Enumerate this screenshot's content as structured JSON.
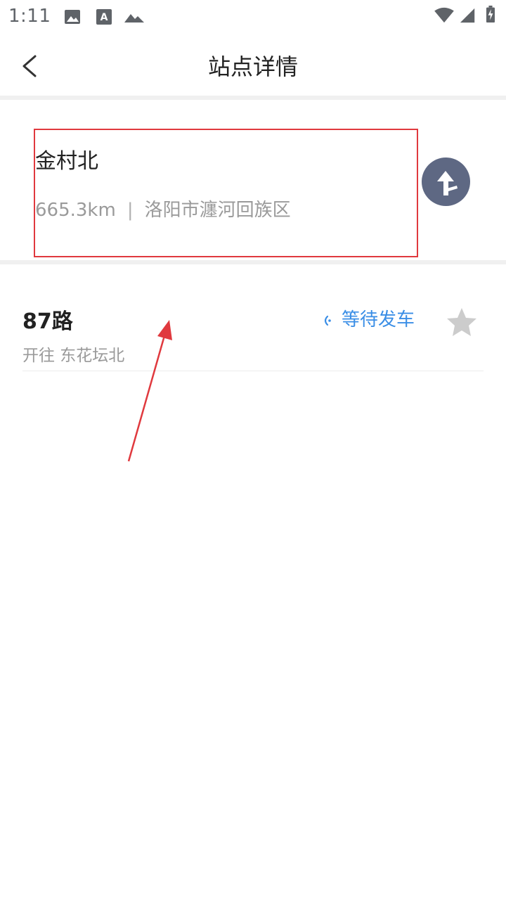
{
  "status_bar": {
    "time": "1:11",
    "icons": [
      "image-icon",
      "font-a-icon",
      "mountain-icon",
      "wifi-icon",
      "signal-icon",
      "battery-charging-icon"
    ]
  },
  "header": {
    "title": "站点详情",
    "back_icon": "chevron-left-icon"
  },
  "station": {
    "name": "金村北",
    "distance": "665.3km",
    "separator": "|",
    "district": "洛阳市瀍河回族区",
    "nav_icon": "turn-arrow-icon"
  },
  "routes": [
    {
      "name": "87路",
      "direction": "开往 东花坛北",
      "status": "等待发车",
      "status_icon": "signal-wave-icon",
      "favorite_icon": "star-icon"
    }
  ],
  "colors": {
    "accent": "#3a8ee6",
    "nav_button": "#5e6883",
    "highlight": "#e0393e",
    "star": "#cccccc"
  }
}
